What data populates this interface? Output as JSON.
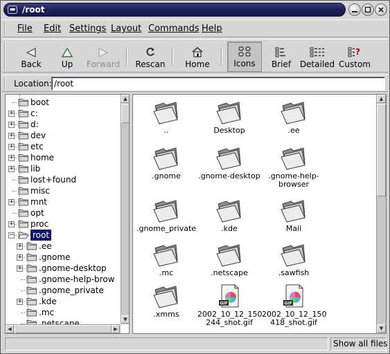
{
  "window": {
    "title": "/root"
  },
  "menubar": {
    "items": [
      {
        "label": "File"
      },
      {
        "label": "Edit"
      },
      {
        "label": "Settings"
      },
      {
        "label": "Layout"
      },
      {
        "label": "Commands"
      },
      {
        "label": "Help"
      }
    ]
  },
  "toolbar": {
    "back": "Back",
    "up": "Up",
    "forward": "Forward",
    "rescan": "Rescan",
    "home": "Home",
    "icons": "Icons",
    "brief": "Brief",
    "detailed": "Detailed",
    "custom": "Custom",
    "active_view": "Icons"
  },
  "location": {
    "label": "Location:",
    "value": "/root"
  },
  "tree": {
    "items": [
      {
        "label": "boot"
      },
      {
        "label": "c:"
      },
      {
        "label": "d:"
      },
      {
        "label": "dev"
      },
      {
        "label": "etc"
      },
      {
        "label": "home"
      },
      {
        "label": "lib"
      },
      {
        "label": "lost+found"
      },
      {
        "label": "misc"
      },
      {
        "label": "mnt"
      },
      {
        "label": "opt"
      },
      {
        "label": "proc"
      },
      {
        "label": "root"
      },
      {
        "label": ".ee"
      },
      {
        "label": ".gnome"
      },
      {
        "label": ".gnome-desktop"
      },
      {
        "label": ".gnome-help-brow"
      },
      {
        "label": ".gnome_private"
      },
      {
        "label": ".kde"
      },
      {
        "label": ".mc"
      },
      {
        "label": ".netscape"
      }
    ]
  },
  "files": [
    {
      "name": "..",
      "type": "folder"
    },
    {
      "name": "Desktop",
      "type": "folder"
    },
    {
      "name": ".ee",
      "type": "folder"
    },
    {
      "name": ".gnome",
      "type": "folder"
    },
    {
      "name": ".gnome-desktop",
      "type": "folder"
    },
    {
      "name": ".gnome-help-\nbrowser",
      "type": "folder"
    },
    {
      "name": ".gnome_private",
      "type": "folder"
    },
    {
      "name": ".kde",
      "type": "folder"
    },
    {
      "name": "Mail",
      "type": "folder"
    },
    {
      "name": ".mc",
      "type": "folder"
    },
    {
      "name": ".netscape",
      "type": "folder"
    },
    {
      "name": ".sawfish",
      "type": "folder"
    },
    {
      "name": ".xmms",
      "type": "folder"
    },
    {
      "name": "2002_10_12_150\n244_shot.gif",
      "type": "gif"
    },
    {
      "name": "2002_10_12_150\n418_shot.gif",
      "type": "gif"
    }
  ],
  "status": {
    "left": "",
    "right": "Show all files"
  },
  "colors": {
    "selection": "#13156a",
    "title_bar": "#1c1f55"
  }
}
